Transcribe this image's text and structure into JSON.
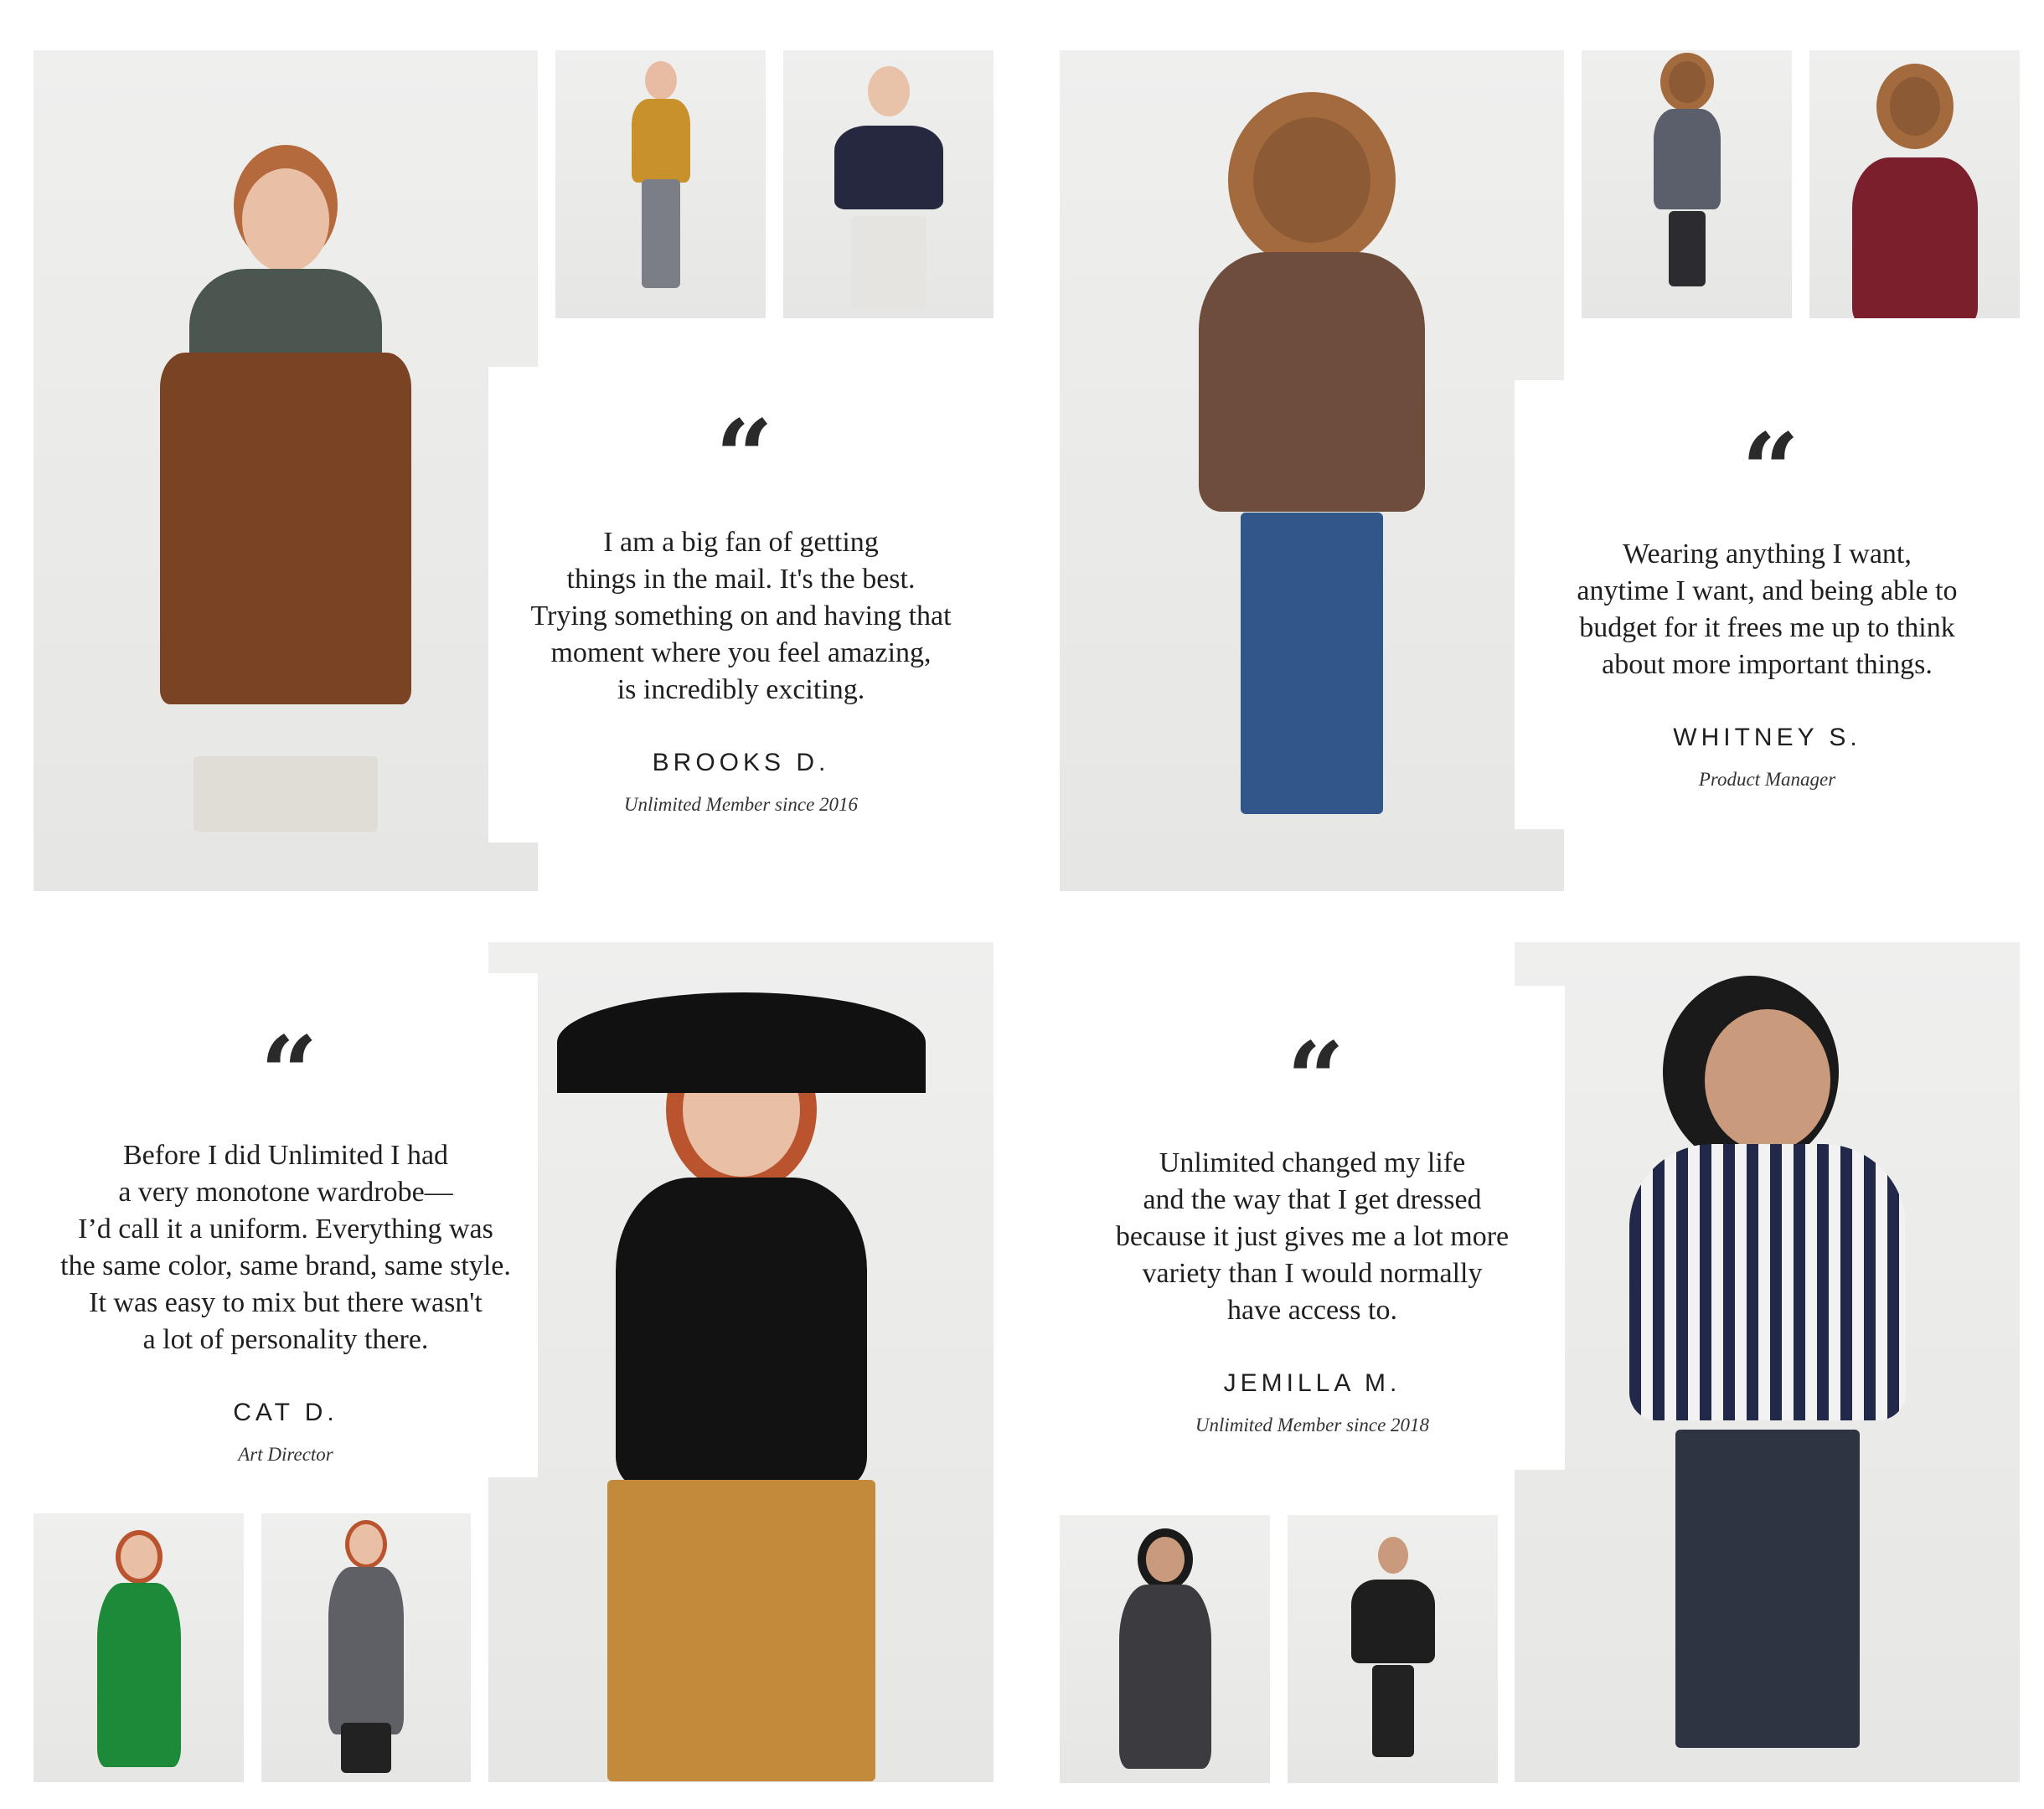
{
  "testimonials": [
    {
      "text": "I am a big fan of getting\nthings in the mail. It's the best.\nTrying something on and having that\nmoment where you feel amazing,\nis incredibly exciting.",
      "name": "BROOKS D.",
      "role": "Unlimited Member since 2016"
    },
    {
      "text": "Wearing anything I want,\nanytime I want, and being able to\nbudget for it frees me up to think\nabout more important things.",
      "name": "WHITNEY S.",
      "role": "Product Manager"
    },
    {
      "text": "Before I did Unlimited I had\na very monotone wardrobe—\nI’d call it a uniform. Everything was\nthe same color, same brand, same style.\nIt was easy to mix but there wasn't\na lot of personality there.",
      "name": "CAT D.",
      "role": "Art Director"
    },
    {
      "text": "Unlimited changed my life\nand the way that I get dressed\nbecause it just gives me a lot more\nvariety than I would normally\nhave access to.",
      "name": "JEMILLA M.",
      "role": "Unlimited Member since 2018"
    }
  ],
  "quote_glyph": "“",
  "colors": {
    "photo_bg": "#ebebea",
    "text": "#1f1f1f"
  }
}
